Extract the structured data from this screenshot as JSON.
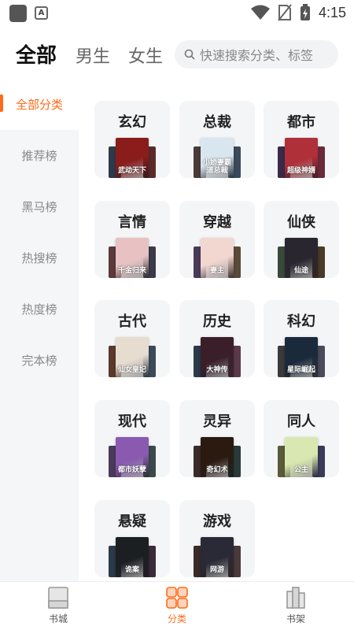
{
  "status_bar": {
    "time": "4:15",
    "app_icon_letter": "A"
  },
  "top_tabs": [
    {
      "label": "全部",
      "active": true
    },
    {
      "label": "男生",
      "active": false
    },
    {
      "label": "女生",
      "active": false
    }
  ],
  "search": {
    "placeholder": "快速搜索分类、标签"
  },
  "sidebar": {
    "items": [
      {
        "label": "全部分类",
        "active": true
      },
      {
        "label": "推荐榜",
        "active": false
      },
      {
        "label": "黑马榜",
        "active": false
      },
      {
        "label": "热搜榜",
        "active": false
      },
      {
        "label": "热度榜",
        "active": false
      },
      {
        "label": "完本榜",
        "active": false
      }
    ]
  },
  "categories": [
    {
      "label": "玄幻",
      "cover_title": "武动天下",
      "cover_color": "#8a1c1c",
      "back_left": "#2e3a4a",
      "back_right": "#5a2a2a"
    },
    {
      "label": "总裁",
      "cover_title": "小娇妻霸道总裁",
      "cover_color": "#d9e6ef",
      "back_left": "#4a3a3a",
      "back_right": "#3a4a5a"
    },
    {
      "label": "都市",
      "cover_title": "超级神婿",
      "cover_color": "#b0303a",
      "back_left": "#3a2a4a",
      "back_right": "#6a2a3a"
    },
    {
      "label": "言情",
      "cover_title": "千金归来",
      "cover_color": "#e8c2c2",
      "back_left": "#5a3a3a",
      "back_right": "#3a3a4a"
    },
    {
      "label": "穿越",
      "cover_title": "妻主",
      "cover_color": "#f2d6d0",
      "back_left": "#4a3a5a",
      "back_right": "#5a4a3a"
    },
    {
      "label": "仙侠",
      "cover_title": "仙途",
      "cover_color": "#2a2630",
      "back_left": "#3a4a3a",
      "back_right": "#4a3a2a"
    },
    {
      "label": "古代",
      "cover_title": "仙女皇妃",
      "cover_color": "#e6dcd0",
      "back_left": "#5a3a2a",
      "back_right": "#3a4a5a"
    },
    {
      "label": "历史",
      "cover_title": "大神传",
      "cover_color": "#3a1f2a",
      "back_left": "#2a3a4a",
      "back_right": "#5a3a4a"
    },
    {
      "label": "科幻",
      "cover_title": "星际崛起",
      "cover_color": "#1a2a3a",
      "back_left": "#3a3a3a",
      "back_right": "#4a4a5a"
    },
    {
      "label": "现代",
      "cover_title": "都市妖孽",
      "cover_color": "#8a5ab0",
      "back_left": "#4a3a5a",
      "back_right": "#3a4a4a"
    },
    {
      "label": "灵异",
      "cover_title": "奇幻术",
      "cover_color": "#2a1a10",
      "back_left": "#3a2a2a",
      "back_right": "#2a3a3a"
    },
    {
      "label": "同人",
      "cover_title": "公主",
      "cover_color": "#d9e8b0",
      "back_left": "#5a5a3a",
      "back_right": "#3a3a5a"
    },
    {
      "label": "悬疑",
      "cover_title": "诡案",
      "cover_color": "#1c1f22",
      "back_left": "#2a3a4a",
      "back_right": "#3a2a3a"
    },
    {
      "label": "游戏",
      "cover_title": "网游",
      "cover_color": "#2a2a36",
      "back_left": "#3a2a2a",
      "back_right": "#4a3a3a"
    }
  ],
  "bottom_nav": [
    {
      "label": "书城",
      "active": false
    },
    {
      "label": "分类",
      "active": true
    },
    {
      "label": "书架",
      "active": false
    }
  ],
  "colors": {
    "accent": "#ff6b1a"
  }
}
